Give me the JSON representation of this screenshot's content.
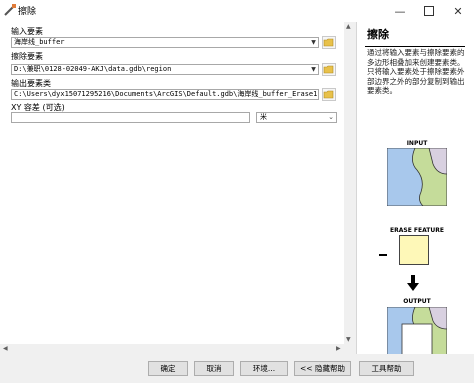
{
  "window": {
    "title": "擦除",
    "minimize_icon": "minimize-icon",
    "maximize_icon": "maximize-icon",
    "close_icon": "close-icon"
  },
  "form": {
    "input_label": "输入要素",
    "input_value": "海岸线_buffer",
    "erase_label": "擦除要素",
    "erase_value": "D:\\兼职\\0128-02049-AKJ\\data.gdb\\region",
    "output_label": "输出要素类",
    "output_value": "C:\\Users\\dyx15071295216\\Documents\\ArcGIS\\Default.gdb\\海岸线_buffer_Erase1",
    "tolerance_label": "XY 容差 (可选)",
    "tolerance_value": "",
    "unit_value": "米"
  },
  "help": {
    "title": "擦除",
    "description": "通过将输入要素与擦除要素的多边形相叠加来创建要素类。只将输入要素处于擦除要素外部边界之外的部分复制到输出要素类。",
    "fig_input": "INPUT",
    "fig_erase": "ERASE FEATURE",
    "fig_output": "OUTPUT"
  },
  "buttons": {
    "ok": "确定",
    "cancel": "取消",
    "env": "环境...",
    "hide_help": "<< 隐藏帮助",
    "tool_help": "工具帮助"
  },
  "colors": {
    "land": "#c5dc9a",
    "water": "#a8c8ec",
    "purple": "#d8d0e0",
    "erase": "#fef8b8"
  }
}
